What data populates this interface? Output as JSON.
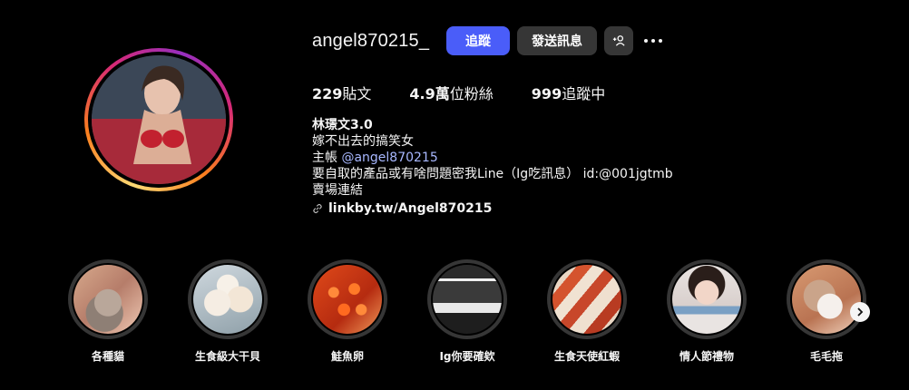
{
  "profile": {
    "username": "angel870215_",
    "follow_label": "追蹤",
    "message_label": "發送訊息",
    "suggest_icon": "+人",
    "stats": {
      "posts_count": "229",
      "posts_label": "貼文",
      "followers_count": "4.9萬",
      "followers_label": "位粉絲",
      "following_count": "999",
      "following_label": "追蹤中"
    },
    "bio": {
      "name": "林璟文3.0",
      "line1": "嫁不出去的搞笑女",
      "line2_prefix": "主帳 ",
      "mention": "@angel870215",
      "line3": "要自取的產品或有啥問題密我Line（Ig吃訊息） id:@001jgtmb",
      "line4": "賣場連結",
      "link": "linkby.tw/Angel870215"
    }
  },
  "highlights": [
    {
      "label": "各種貓"
    },
    {
      "label": "生食級大干貝"
    },
    {
      "label": "鮭魚卵"
    },
    {
      "label": "Ig你要確欸"
    },
    {
      "label": "生食天使紅蝦"
    },
    {
      "label": "情人節禮物"
    },
    {
      "label": "毛毛拖"
    }
  ],
  "icons": {
    "more": "more-horizontal-icon",
    "link": "chain-link-icon",
    "next": "chevron-right-icon"
  },
  "colors": {
    "follow_button": "#4a5df9",
    "secondary_button": "#363636",
    "mention": "#a8b8ff",
    "background": "#000000"
  }
}
